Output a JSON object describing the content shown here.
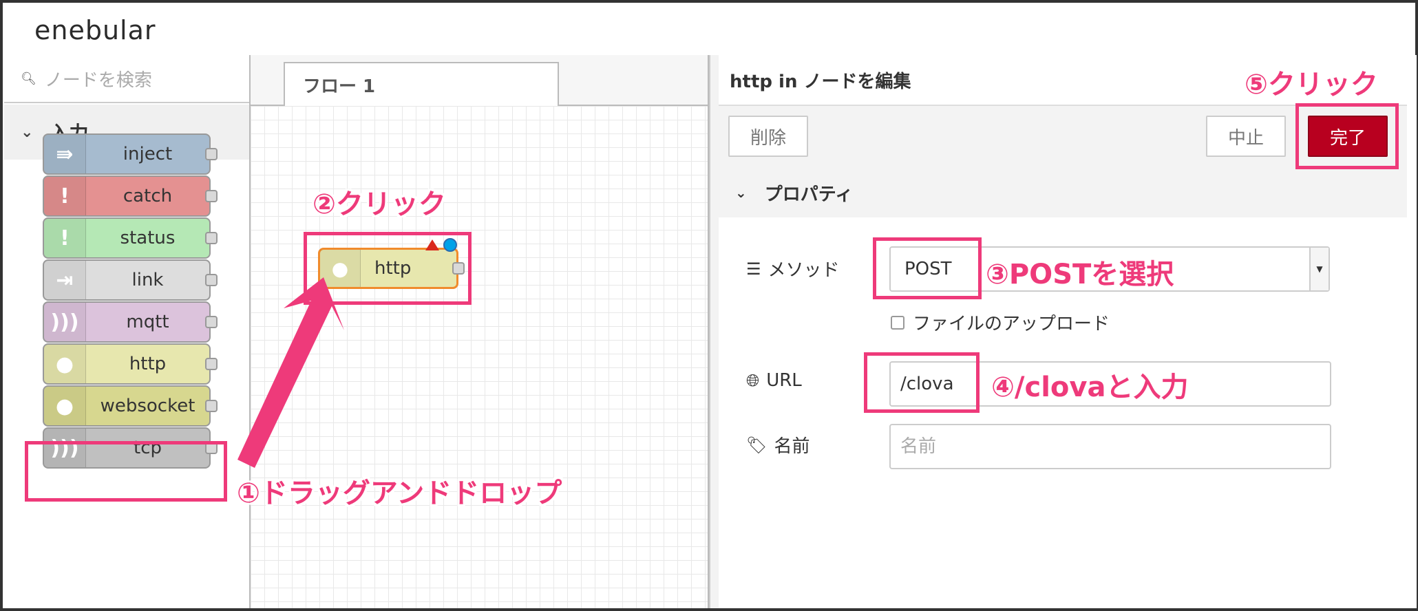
{
  "app": {
    "logo": "enebular"
  },
  "palette": {
    "search_placeholder": "ノードを検索",
    "category": "入力",
    "nodes": [
      {
        "label": "inject",
        "color": "#a6bbcf",
        "icon": "arrow-in-icon"
      },
      {
        "label": "catch",
        "color": "#e49191",
        "icon": "exclamation-icon"
      },
      {
        "label": "status",
        "color": "#c0edc0",
        "icon": "exclamation-icon"
      },
      {
        "label": "link",
        "color": "#dddddd",
        "icon": "link-in-icon"
      },
      {
        "label": "mqtt",
        "color": "#d8bfd8",
        "icon": "radio-waves-icon"
      },
      {
        "label": "http",
        "color": "#e7e7ae",
        "icon": "globe-icon"
      },
      {
        "label": "websocket",
        "color": "#d7d78f",
        "icon": "globe-icon"
      },
      {
        "label": "tcp",
        "color": "#c0c0c0",
        "icon": "radio-waves-icon"
      }
    ]
  },
  "workspace": {
    "tab_label": "フロー 1",
    "node": {
      "label": "http"
    }
  },
  "editor": {
    "title": "http in ノードを編集",
    "delete_label": "削除",
    "cancel_label": "中止",
    "done_label": "完了",
    "section_label": "プロパティ",
    "method_label": "メソッド",
    "method_value": "POST",
    "upload_label": "ファイルのアップロード",
    "url_label": "URL",
    "url_value": "/clova",
    "name_label": "名前",
    "name_placeholder": "名前"
  },
  "annotations": {
    "step1": "①ドラッグアンドドロップ",
    "step2": "②クリック",
    "step3": "③POSTを選択",
    "step4": "④/clovaと入力",
    "step5": "⑤クリック",
    "color": "#ee3a7a"
  }
}
